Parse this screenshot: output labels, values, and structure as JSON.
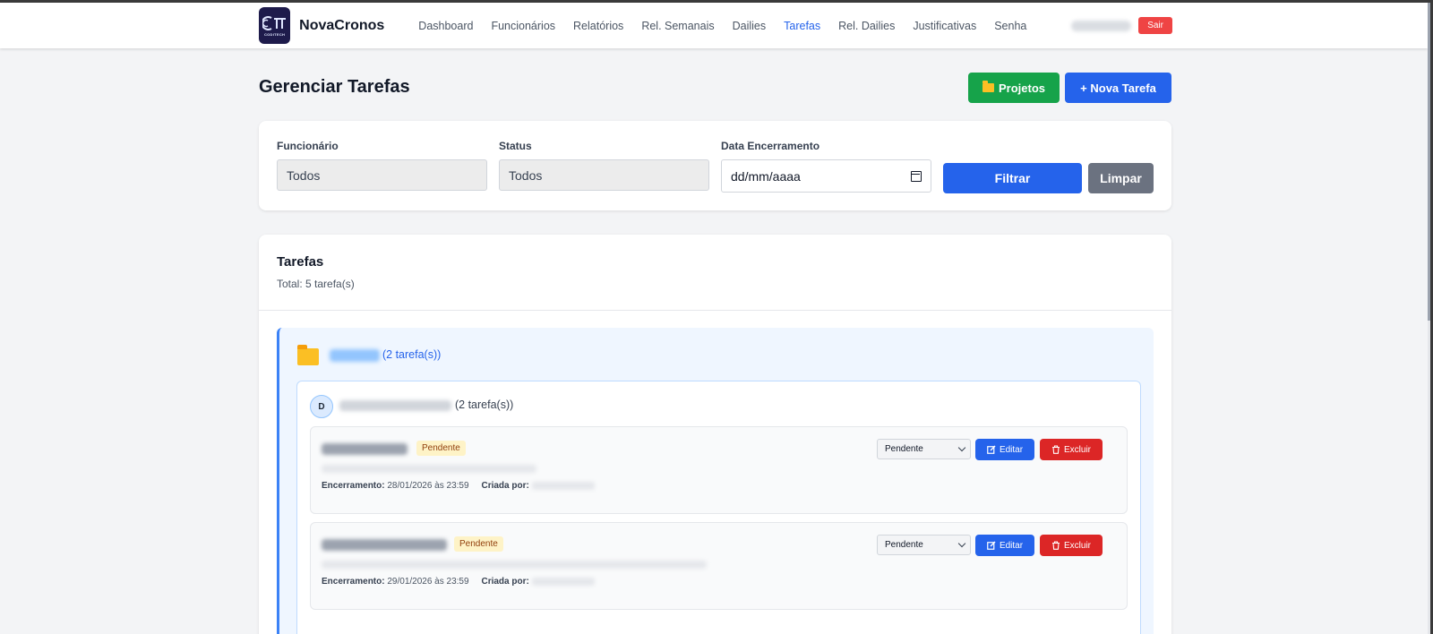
{
  "brand": {
    "name": "NovaCronos",
    "logo_text": "CODITECH"
  },
  "nav": {
    "links": [
      "Dashboard",
      "Funcionários",
      "Relatórios",
      "Rel. Semanais",
      "Dailies",
      "Tarefas",
      "Rel. Dailies",
      "Justificativas",
      "Senha"
    ],
    "active": "Tarefas",
    "logout_label": "Sair"
  },
  "page": {
    "title": "Gerenciar Tarefas",
    "projects_button": "Projetos",
    "new_task_button": "+ Nova Tarefa"
  },
  "filters": {
    "employee_label": "Funcionário",
    "employee_value": "Todos",
    "status_label": "Status",
    "status_value": "Todos",
    "date_label": "Data Encerramento",
    "date_placeholder": "dd/mm/aaaa",
    "filter_button": "Filtrar",
    "clear_button": "Limpar"
  },
  "tasks_section": {
    "title": "Tarefas",
    "total": "Total: 5 tarefa(s)"
  },
  "project_group": {
    "count": "(2 tarefa(s))",
    "user": {
      "initial": "D",
      "count": "(2 tarefa(s))",
      "tasks": [
        {
          "badge": "Pendente",
          "status": "Pendente",
          "closing_label": "Encerramento:",
          "closing_value": "28/01/2026 às 23:59",
          "created_label": "Criada por:",
          "edit_label": "Editar",
          "delete_label": "Excluir"
        },
        {
          "badge": "Pendente",
          "status": "Pendente",
          "closing_label": "Encerramento:",
          "closing_value": "29/01/2026 às 23:59",
          "created_label": "Criada por:",
          "edit_label": "Editar",
          "delete_label": "Excluir"
        }
      ]
    }
  },
  "colors": {
    "primary": "#2563eb",
    "success": "#16a34a",
    "danger": "#dc2626",
    "muted": "#6b7280",
    "badge_bg": "#fef3c7"
  }
}
